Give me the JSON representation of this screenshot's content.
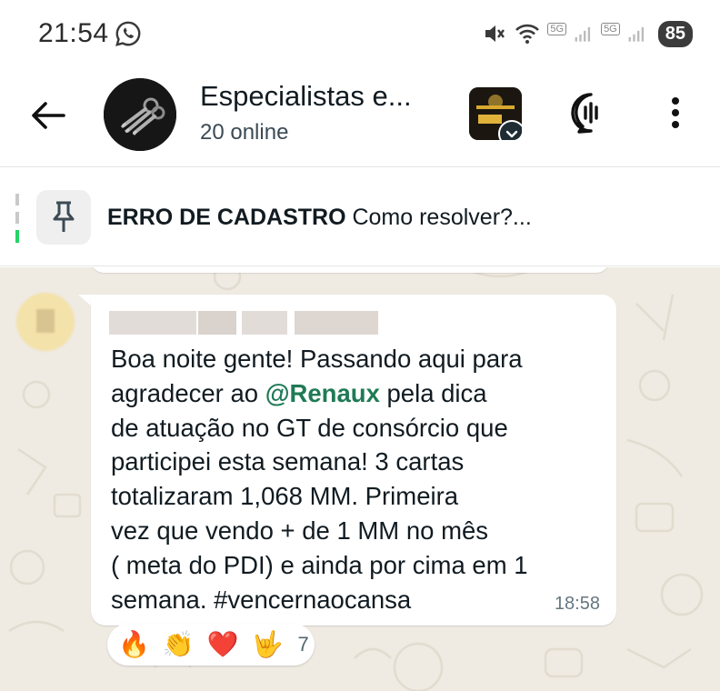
{
  "status_bar": {
    "time": "21:54",
    "battery": "85",
    "network_5g_1": "5G",
    "network_5g_2": "5G",
    "icons": [
      "whatsapp-icon",
      "mute-icon",
      "wifi-icon",
      "signal-icon",
      "signal-icon"
    ]
  },
  "header": {
    "title": "Especialistas e...",
    "subtitle": "20 online",
    "community_badge": "VENCER EDUCAÇÃO ACE"
  },
  "pinned": {
    "bold": "ERRO DE CADASTRO",
    "rest": "Como resolver?..."
  },
  "message": {
    "text_before": "Boa noite gente! Passando aqui para\nagradecer ao ",
    "mention": "@Renaux",
    "text_after": " pela dica\nde atuação no GT de consórcio que\nparticipei esta semana! 3 cartas\ntotalizaram 1,068 MM. Primeira\nvez que vendo + de 1 MM no mês\n( meta do PDI) e ainda por cima em 1\nsemana. #vencernaocansa",
    "time": "18:58"
  },
  "reactions": {
    "emojis": [
      "🔥",
      "👏",
      "❤️",
      "🤟"
    ],
    "count": "7"
  },
  "colors": {
    "chat_bg": "#efeae2",
    "mention": "#1f7a55",
    "bubble": "#ffffff"
  }
}
